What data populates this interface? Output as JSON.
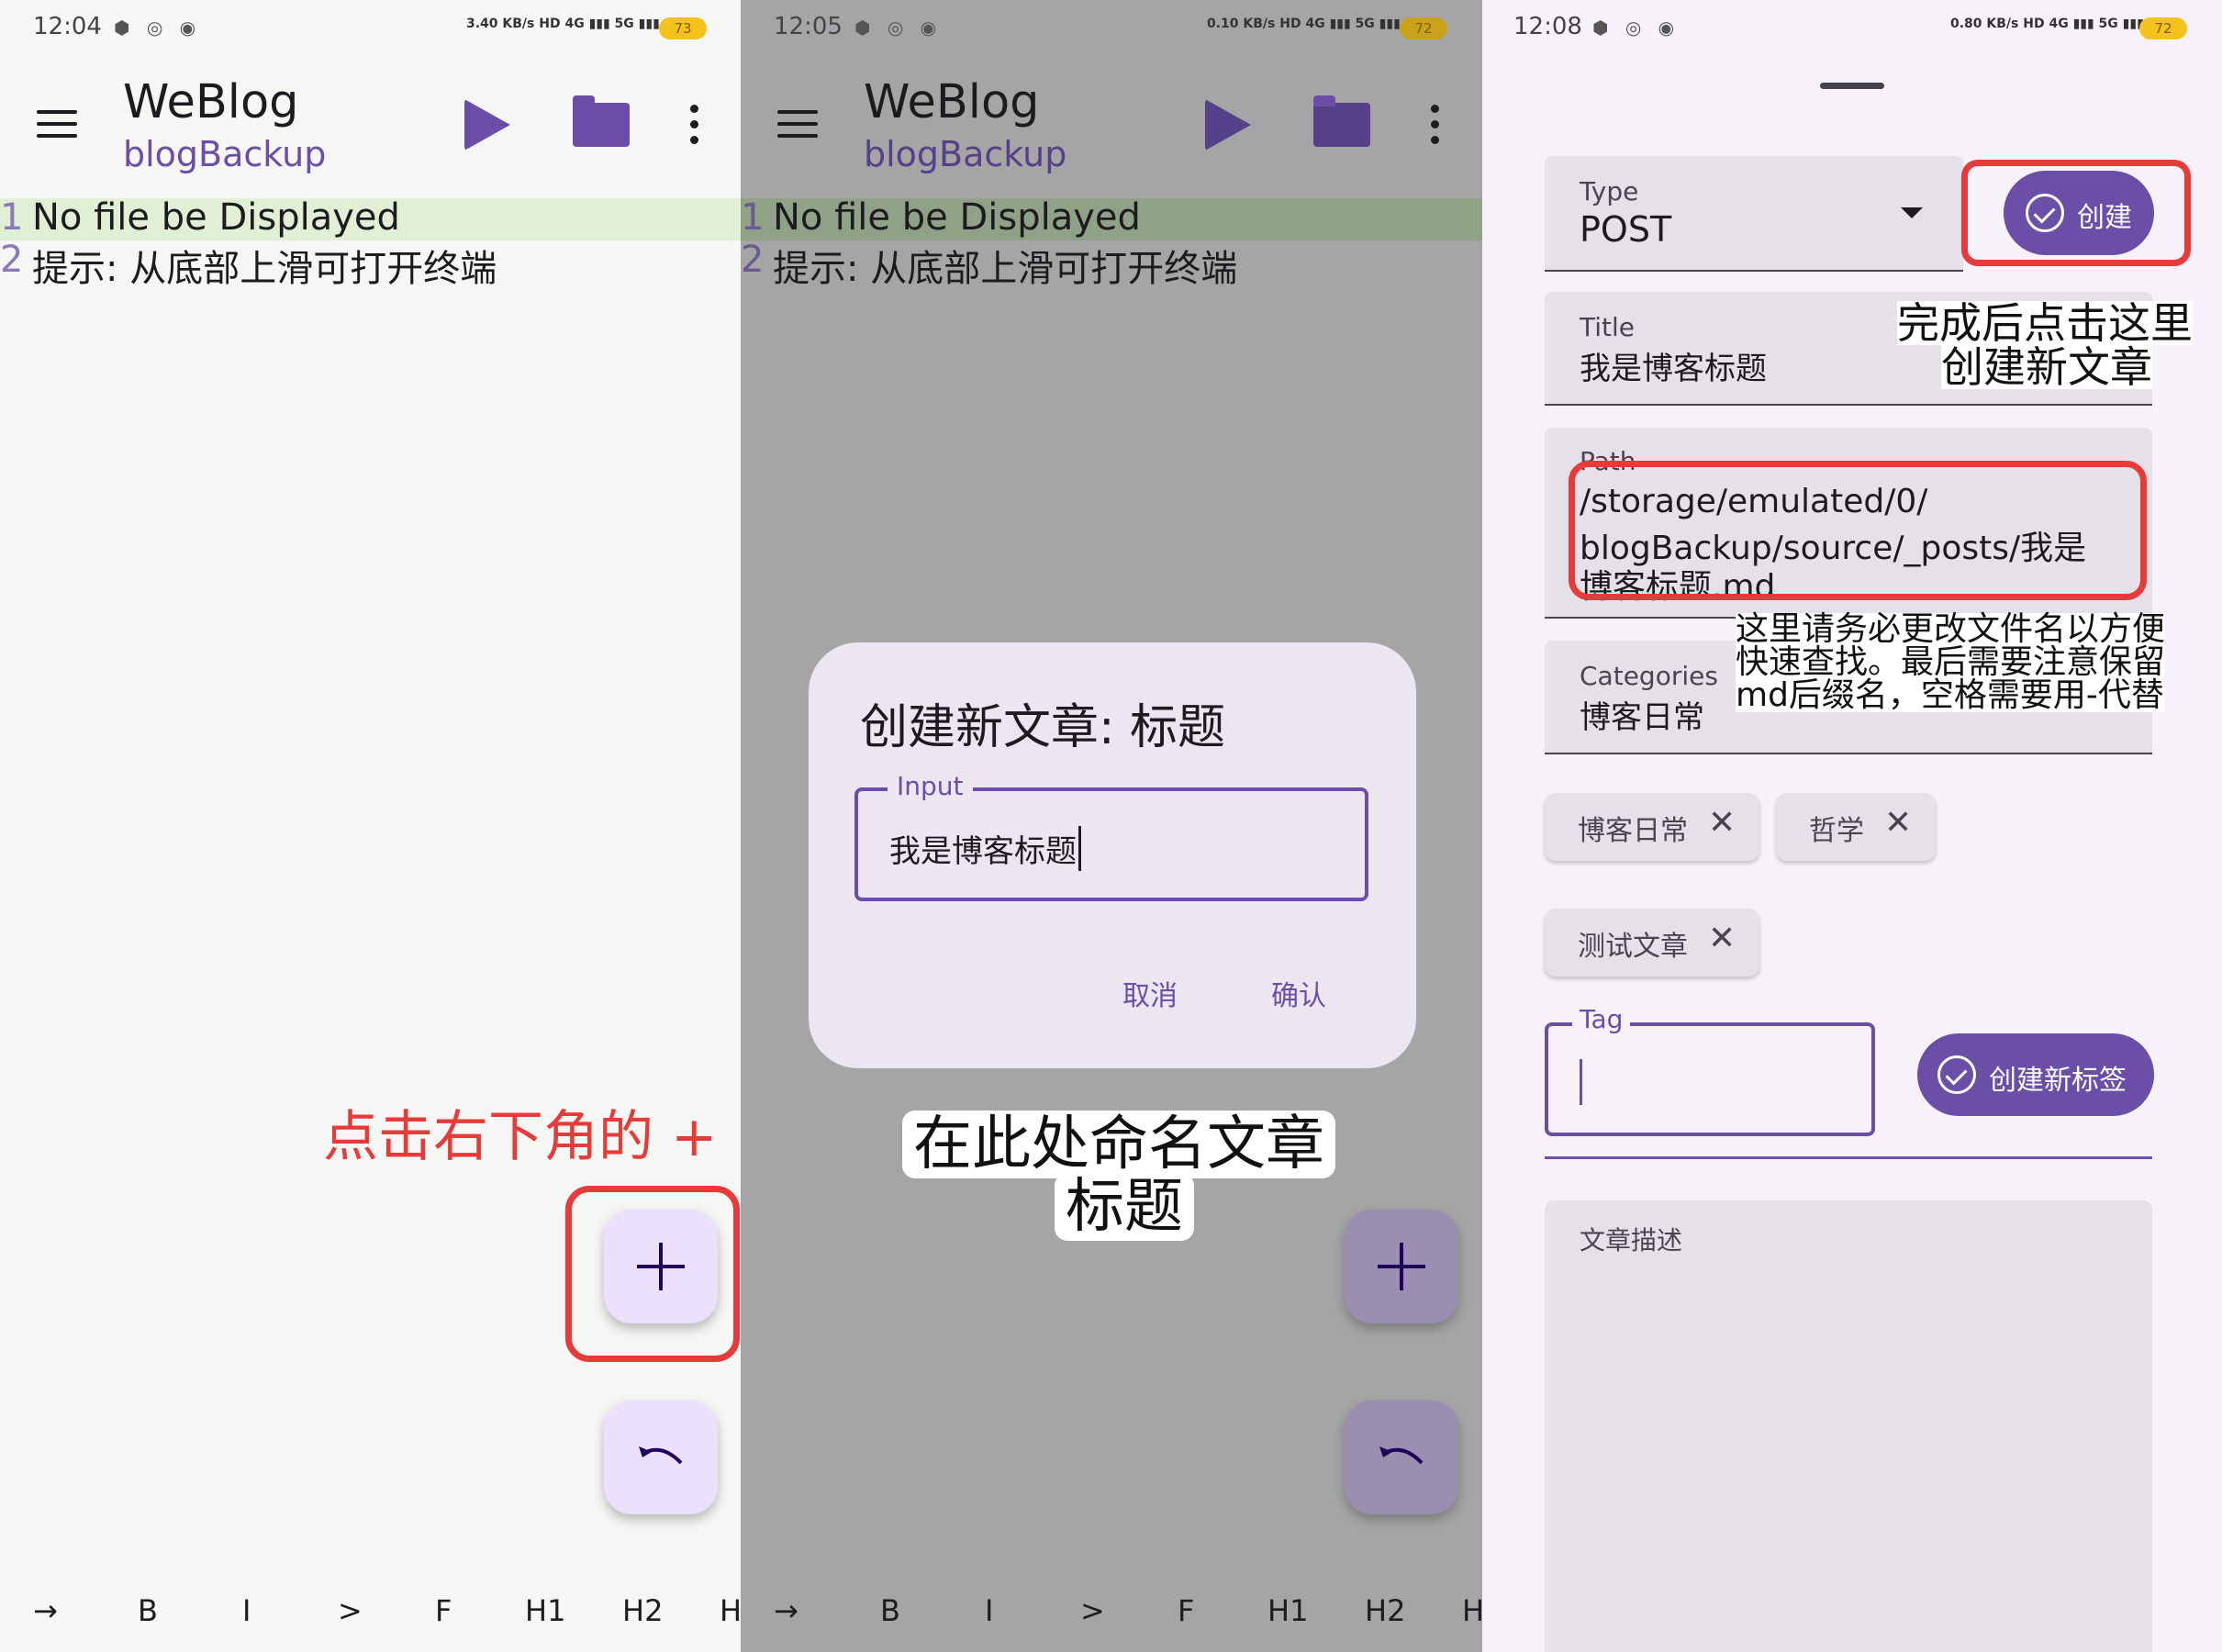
{
  "panel1": {
    "status": {
      "time": "12:04",
      "apps": "⬢ ◎ ◉",
      "signal": "3.40 KB/s HD 4G ▮▮▮ 5G ▮▮▮ ≋",
      "battery": "73"
    },
    "appbar": {
      "title": "WeBlog",
      "subtitle": "blogBackup"
    },
    "editor": {
      "lines": [
        {
          "num": "1",
          "text": "No file be Displayed"
        },
        {
          "num": "2",
          "text": "提示: 从底部上滑可打开终端"
        }
      ]
    },
    "annotation": "点击右下角的 +",
    "toolbar": [
      "→",
      "B",
      "I",
      ">",
      "F",
      "H1",
      "H2",
      "H"
    ]
  },
  "panel2": {
    "status": {
      "time": "12:05",
      "apps": "⬢ ◎ ◉",
      "signal": "0.10 KB/s HD 4G ▮▮▮ 5G ▮▮▮ ≋",
      "battery": "72"
    },
    "appbar": {
      "title": "WeBlog",
      "subtitle": "blogBackup"
    },
    "editor": {
      "lines": [
        {
          "num": "1",
          "text": "No file be Displayed"
        },
        {
          "num": "2",
          "text": "提示: 从底部上滑可打开终端"
        }
      ]
    },
    "dialog": {
      "title": "创建新文章: 标题",
      "input_label": "Input",
      "input_value": "我是博客标题",
      "cancel": "取消",
      "confirm": "确认"
    },
    "annotation": {
      "line1": "在此处命名文章",
      "line2": "标题"
    },
    "toolbar": [
      "→",
      "B",
      "I",
      ">",
      "F",
      "H1",
      "H2",
      "H"
    ]
  },
  "panel3": {
    "status": {
      "time": "12:08",
      "apps": "⬢ ◎ ◉",
      "signal": "0.80 KB/s HD 4G ▮▮▮ 5G ▮▮▮ ≋",
      "battery": "72"
    },
    "type": {
      "label": "Type",
      "value": "POST"
    },
    "create_button": "创建",
    "title": {
      "label": "Title",
      "value": "我是博客标题"
    },
    "path": {
      "label": "Path",
      "line1": "/storage/emulated/0/",
      "line2": "blogBackup/source/_posts/我是",
      "line3": "博客标题.md"
    },
    "categories": {
      "label": "Categories",
      "value": "博客日常"
    },
    "chips": [
      "博客日常",
      "哲学",
      "测试文章"
    ],
    "tag": {
      "label": "Tag",
      "value": ""
    },
    "create_tag_button": "创建新标签",
    "description": {
      "label": "文章描述"
    },
    "annotation_create": {
      "line1": "完成后点击这里",
      "line2": "创建新文章"
    },
    "annotation_path": {
      "line1": "这里请务必更改文件名以方便",
      "line2": "快速查找。最后需要注意保留",
      "line3": "md后缀名，空格需要用-代替"
    }
  },
  "colors": {
    "accent": "#6a4ea8",
    "annotation_red": "#e63b3b",
    "fab": "#ece1fc"
  }
}
